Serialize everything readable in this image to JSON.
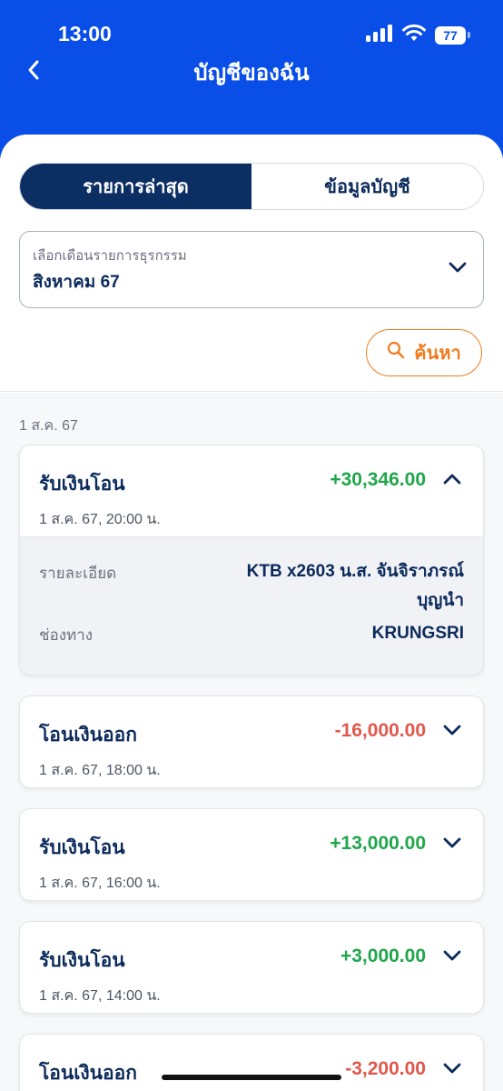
{
  "status_bar": {
    "time": "13:00",
    "battery": "77"
  },
  "header": {
    "title": "บัญชีของฉัน"
  },
  "tabs": [
    {
      "label": "รายการล่าสุด",
      "active": true
    },
    {
      "label": "ข้อมูลบัญชี",
      "active": false
    }
  ],
  "month_select": {
    "label": "เลือกเดือนรายการธุรกรรม",
    "value": "สิงหาคม 67"
  },
  "search": {
    "label": "ค้นหา"
  },
  "date_group": "1 ส.ค. 67",
  "transactions": [
    {
      "title": "รับเงินโอน",
      "time": "1 ส.ค. 67, 20:00 น.",
      "amount": "+30,346.00",
      "direction": "in",
      "expanded": true,
      "details": {
        "detail_label": "รายละเอียด",
        "detail_value_line1": "KTB x2603 น.ส. จันจิราภรณ์",
        "detail_value_line2": "บุญนำ",
        "channel_label": "ช่องทาง",
        "channel_value": "KRUNGSRI"
      }
    },
    {
      "title": "โอนเงินออก",
      "time": "1 ส.ค. 67, 18:00 น.",
      "amount": "-16,000.00",
      "direction": "out",
      "expanded": false
    },
    {
      "title": "รับเงินโอน",
      "time": "1 ส.ค. 67, 16:00 น.",
      "amount": "+13,000.00",
      "direction": "in",
      "expanded": false
    },
    {
      "title": "รับเงินโอน",
      "time": "1 ส.ค. 67, 14:00 น.",
      "amount": "+3,000.00",
      "direction": "in",
      "expanded": false
    },
    {
      "title": "โอนเงินออก",
      "time": "",
      "amount": "-3,200.00",
      "direction": "out",
      "expanded": false
    }
  ],
  "colors": {
    "brand_blue": "#0a4ee8",
    "navy": "#0b2e63",
    "orange": "#f07c1e",
    "green": "#1fa64a",
    "red": "#e0574b"
  }
}
